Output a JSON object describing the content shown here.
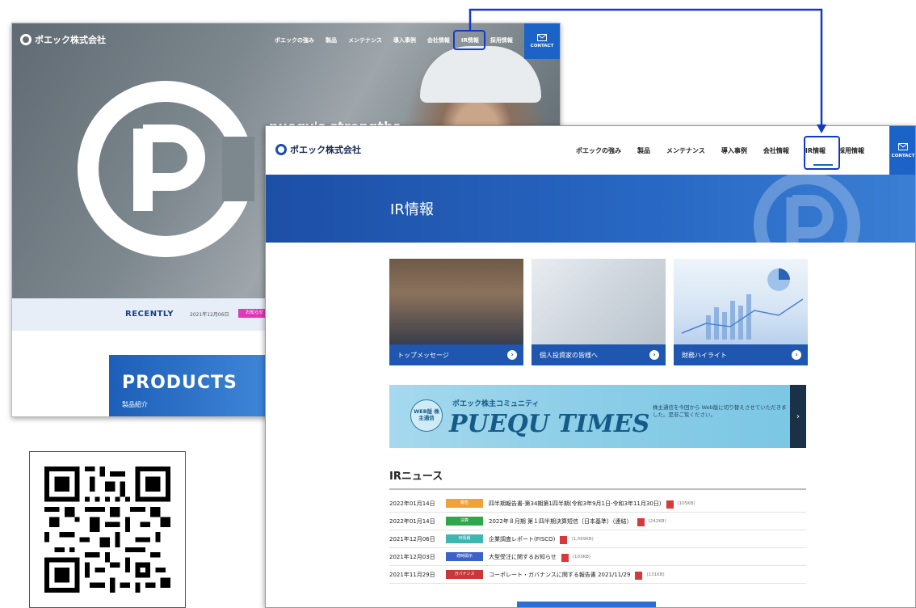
{
  "back_screenshot": {
    "brand": "ポエック株式会社",
    "nav": [
      "ポエックの強み",
      "製品",
      "メンテナンス",
      "導入事例",
      "会社情報",
      "IR情報",
      "採用情報"
    ],
    "contact_label": "CONTACT",
    "hero_text": "pueqy's strengths",
    "recently_label": "RECENTLY",
    "recently_date": "2021年12月06日",
    "recently_badge": "お知らせ",
    "products_title": "PRODUCTS",
    "products_sub": "製品紹介"
  },
  "front_screenshot": {
    "brand": "ポエック株式会社",
    "nav": [
      "ポエックの強み",
      "製品",
      "メンテナンス",
      "導入事例",
      "会社情報",
      "IR情報",
      "採用情報"
    ],
    "contact_label": "CONTACT",
    "page_title": "IR情報",
    "cards": [
      {
        "label": "トップメッセージ"
      },
      {
        "label": "個人投資家の皆様へ"
      },
      {
        "label": "財務ハイライト"
      }
    ],
    "times_banner": {
      "seal": "WEB版 株主通信",
      "subtitle": "ポエック株主コミュニティ",
      "title": "PUEQU TIMES",
      "note": "株主通信を今回から Web版に切り替えさせていただきました。是非ご覧ください。"
    },
    "news_title": "IRニュース",
    "news": [
      {
        "date": "2022年01月14日",
        "badge": "報告",
        "badge_color": "#f0a23a",
        "title": "四半期報告書-第34期第1四半期(令和3年9月1日-令和3年11月30日)",
        "size": "(105KB)"
      },
      {
        "date": "2022年01月14日",
        "badge": "決算",
        "badge_color": "#2ea84a",
        "title": "2022年８月期 第１四半期決算短信〔日本基準〕（連結）",
        "size": "(242KB)"
      },
      {
        "date": "2021年12月06日",
        "badge": "IR情報",
        "badge_color": "#3fb6b0",
        "title": "企業調査レポート(FISCO)",
        "size": "(1,569KB)"
      },
      {
        "date": "2021年12月03日",
        "badge": "適時開示",
        "badge_color": "#3a62c8",
        "title": "大型受注に関するお知らせ",
        "size": "(103KB)"
      },
      {
        "date": "2021年11月29日",
        "badge": "ガバナンス",
        "badge_color": "#c93838",
        "title": "コーポレート・ガバナンスに関する報告書 2021/11/29",
        "size": "(131KB)"
      }
    ]
  },
  "colors": {
    "accent_blue": "#1b63c6",
    "highlight_blue": "#1439c8"
  }
}
